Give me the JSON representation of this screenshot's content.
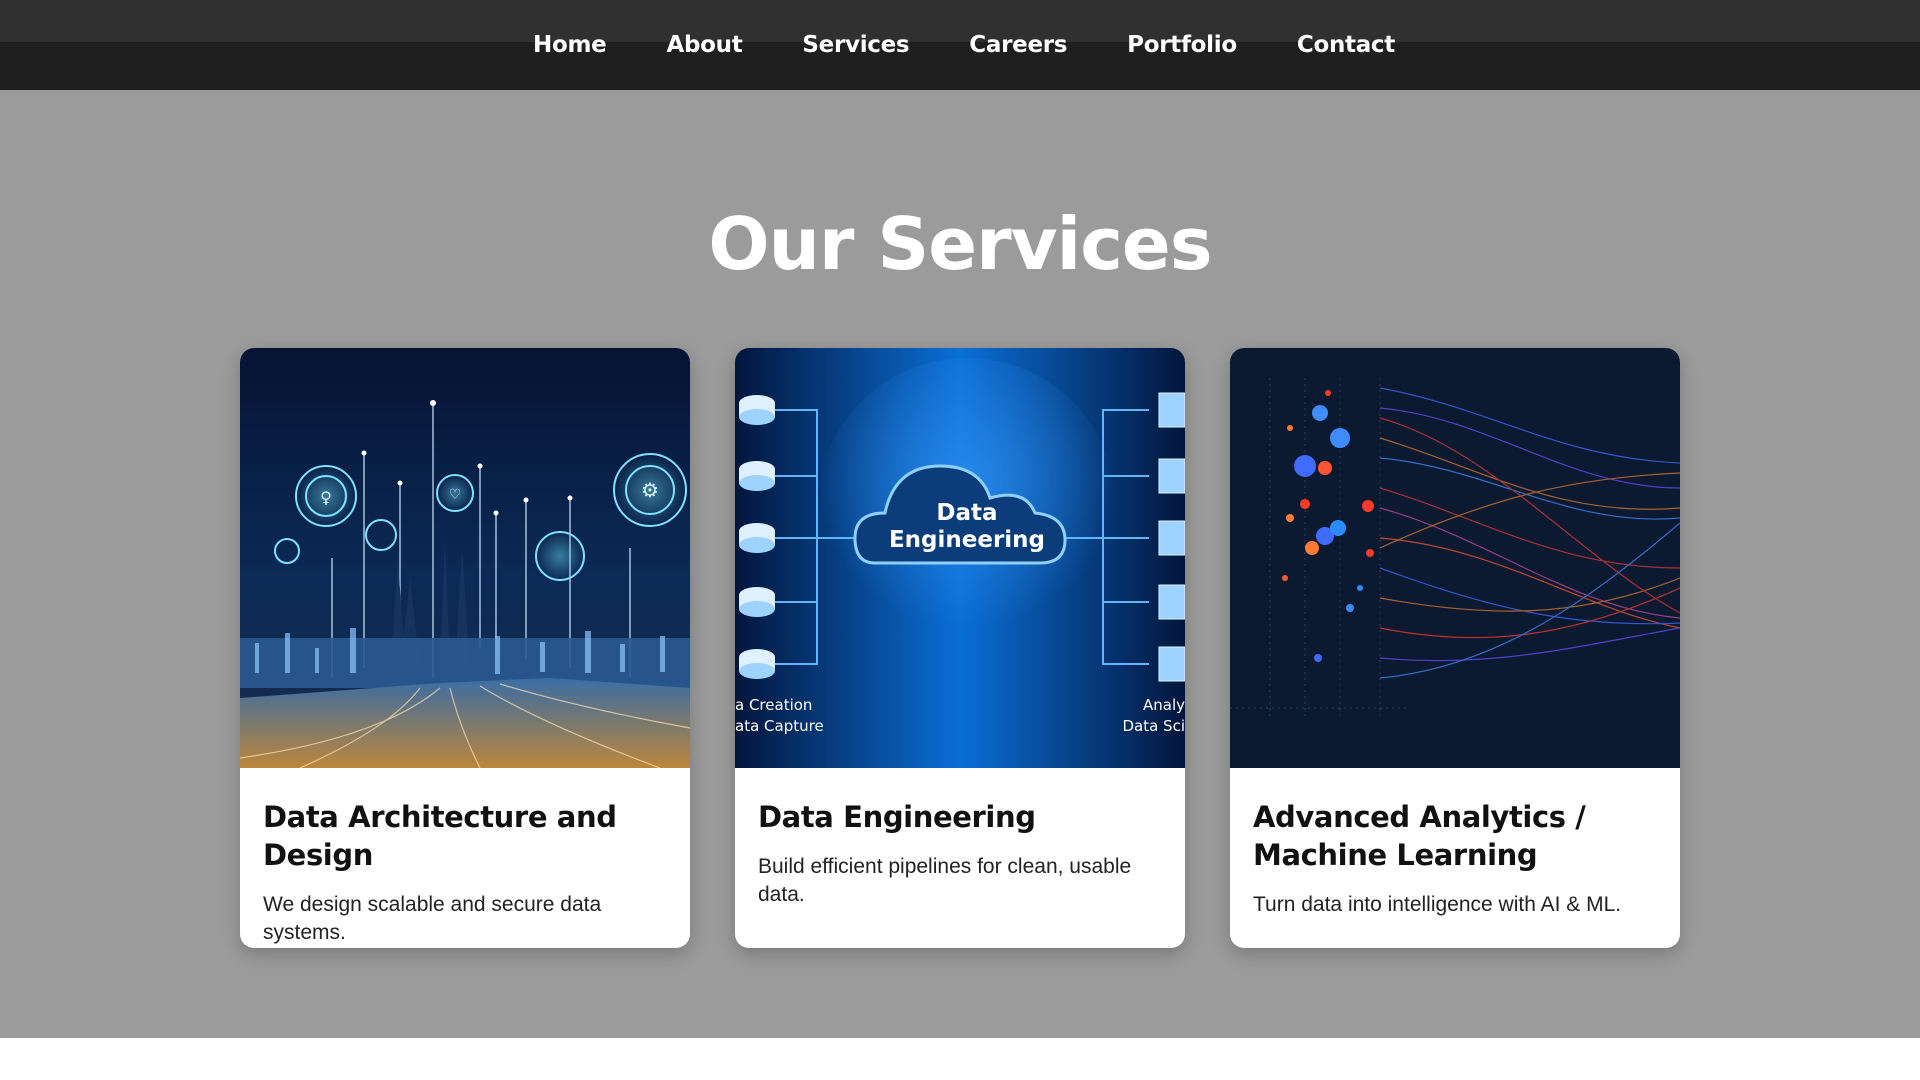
{
  "nav": {
    "items": [
      {
        "label": "Home"
      },
      {
        "label": "About"
      },
      {
        "label": "Services"
      },
      {
        "label": "Careers"
      },
      {
        "label": "Portfolio"
      },
      {
        "label": "Contact"
      }
    ]
  },
  "services": {
    "title": "Our Services",
    "cards": [
      {
        "title": "Data Architecture and Design",
        "description": "We design scalable and secure data systems."
      },
      {
        "title": "Data Engineering",
        "description": "Build efficient pipelines for clean, usable data.",
        "image_text": {
          "cloud_line1": "Data",
          "cloud_line2": "Engineering",
          "left_caption_1": "a Creation",
          "left_caption_2": "ata Capture",
          "right_caption_1": "Analy",
          "right_caption_2": "Data Sci"
        }
      },
      {
        "title": "Advanced Analytics / Machine Learning",
        "description": "Turn data into intelligence with AI & ML."
      }
    ]
  },
  "colors": {
    "nav_bg": "#1f1f1f",
    "section_bg": "#9b9b9b",
    "card_bg": "#ffffff"
  }
}
